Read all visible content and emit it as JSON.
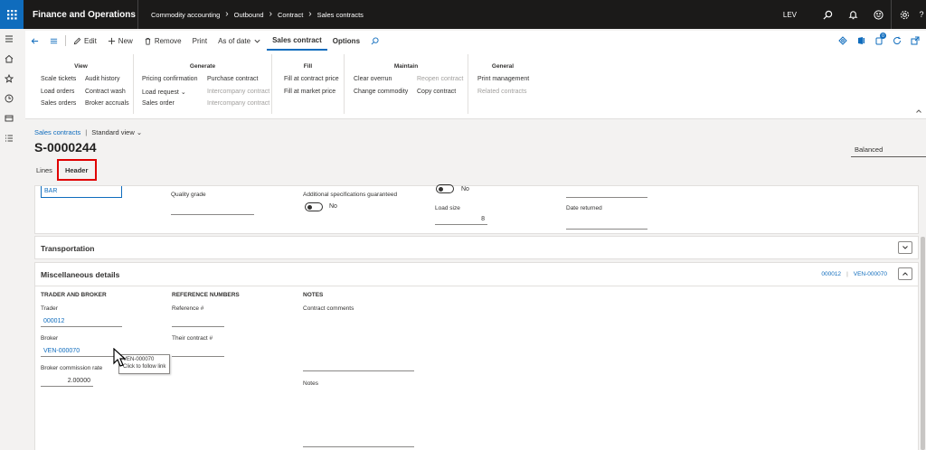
{
  "topbar": {
    "app_title": "Finance and Operations",
    "breadcrumb": [
      "Commodity accounting",
      "Outbound",
      "Contract",
      "Sales contracts"
    ],
    "user": "LEV"
  },
  "actions": {
    "edit": "Edit",
    "new": "New",
    "remove": "Remove",
    "print": "Print",
    "as_of_date": "As of date",
    "tab_sales_contract": "Sales contract",
    "tab_options": "Options",
    "notification_count": "0"
  },
  "groups": {
    "view": {
      "title": "View",
      "items": [
        "Scale tickets",
        "Audit history",
        "Load orders",
        "Contract wash",
        "Sales orders",
        "Broker accruals"
      ]
    },
    "generate": {
      "title": "Generate",
      "items": [
        "Pricing confirmation",
        "Purchase contract",
        "Load request",
        "Intercompany contract",
        "Sales order",
        "Intercompany contract"
      ]
    },
    "fill": {
      "title": "Fill",
      "items": [
        "Fill at contract price",
        "Fill at market price"
      ]
    },
    "maintain": {
      "title": "Maintain",
      "items": [
        "Clear overrun",
        "Reopen contract",
        "Change commodity",
        "Copy contract"
      ]
    },
    "general": {
      "title": "General",
      "items": [
        "Print management",
        "Related contracts"
      ]
    }
  },
  "page": {
    "breadcrumb_link": "Sales contracts",
    "view_name": "Standard view",
    "record_id": "S-0000244",
    "status": "Balanced",
    "tabs": [
      "Lines",
      "Header"
    ]
  },
  "top_card": {
    "bar_value": "BAR",
    "quality_grade_label": "Quality grade",
    "add_spec_label": "Additional specifications guaranteed",
    "add_spec_value": "No",
    "toggle_top_value": "No",
    "load_size_label": "Load size",
    "load_size_value": "8",
    "date_returned_label": "Date returned"
  },
  "transportation": {
    "title": "Transportation"
  },
  "misc": {
    "title": "Miscellaneous details",
    "summary": [
      "000012",
      "VEN-000070"
    ],
    "trader_broker": {
      "heading": "TRADER AND BROKER",
      "trader_label": "Trader",
      "trader_value": "000012",
      "broker_label": "Broker",
      "broker_value": "VEN-000070",
      "commission_label": "Broker commission rate",
      "commission_value": "2.00000"
    },
    "reference": {
      "heading": "REFERENCE NUMBERS",
      "reference_label": "Reference #",
      "their_contract_label": "Their contract #"
    },
    "notes": {
      "heading": "NOTES",
      "contract_comments_label": "Contract comments",
      "notes_label": "Notes"
    }
  },
  "tooltip": {
    "line1": "VEN-000070",
    "line2": "Click to follow link"
  }
}
